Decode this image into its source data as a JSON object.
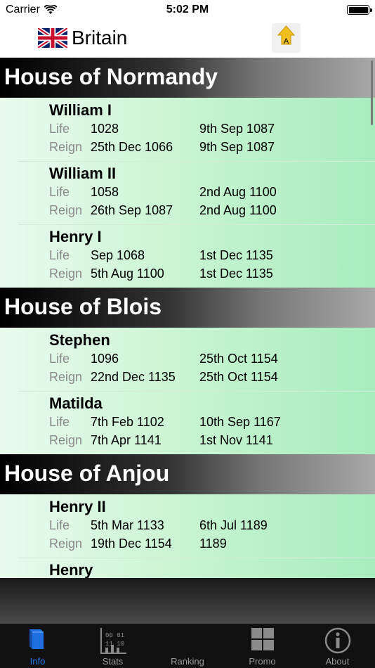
{
  "status_bar": {
    "carrier": "Carrier",
    "time": "5:02 PM"
  },
  "nav": {
    "title": "Britain",
    "flag_icon": "union-jack-flag-icon",
    "right_icon": "arrow-up-a-icon"
  },
  "houses": [
    {
      "name": "House of Normandy",
      "monarchs": [
        {
          "name": "William I",
          "life_label": "Life",
          "life_start": "1028",
          "life_end": "9th Sep 1087",
          "reign_label": "Reign",
          "reign_start": "25th Dec 1066",
          "reign_end": "9th Sep 1087"
        },
        {
          "name": "William II",
          "life_label": "Life",
          "life_start": "1058",
          "life_end": "2nd Aug 1100",
          "reign_label": "Reign",
          "reign_start": "26th Sep 1087",
          "reign_end": "2nd Aug 1100"
        },
        {
          "name": "Henry I",
          "life_label": "Life",
          "life_start": "Sep 1068",
          "life_end": "1st Dec 1135",
          "reign_label": "Reign",
          "reign_start": "5th Aug 1100",
          "reign_end": "1st Dec 1135"
        }
      ]
    },
    {
      "name": "House of Blois",
      "monarchs": [
        {
          "name": "Stephen",
          "life_label": "Life",
          "life_start": "1096",
          "life_end": "25th Oct 1154",
          "reign_label": "Reign",
          "reign_start": "22nd Dec 1135",
          "reign_end": "25th Oct 1154"
        },
        {
          "name": "Matilda",
          "life_label": "Life",
          "life_start": "7th Feb 1102",
          "life_end": "10th Sep 1167",
          "reign_label": "Reign",
          "reign_start": "7th Apr 1141",
          "reign_end": "1st Nov 1141"
        }
      ]
    },
    {
      "name": "House of Anjou",
      "monarchs": [
        {
          "name": "Henry II",
          "life_label": "Life",
          "life_start": "5th Mar 1133",
          "life_end": "6th Jul 1189",
          "reign_label": "Reign",
          "reign_start": "19th Dec 1154",
          "reign_end": "1189"
        },
        {
          "name": "Henry",
          "life_label": "",
          "life_start": "",
          "life_end": "",
          "reign_label": "",
          "reign_start": "",
          "reign_end": ""
        }
      ]
    }
  ],
  "tabs": [
    {
      "label": "Info",
      "icon": "book-icon",
      "active": true
    },
    {
      "label": "Stats",
      "icon": "stats-chart-icon",
      "active": false
    },
    {
      "label": "Ranking",
      "icon": "ranking-icon",
      "active": false
    },
    {
      "label": "Promo",
      "icon": "grid-icon",
      "active": false
    },
    {
      "label": "About",
      "icon": "info-circle-icon",
      "active": false
    }
  ],
  "colors": {
    "accent": "#1e7af0",
    "tab_inactive": "#9a9a9a",
    "row_green": "#a7ecbd",
    "label_gray": "#8a8a8a"
  }
}
